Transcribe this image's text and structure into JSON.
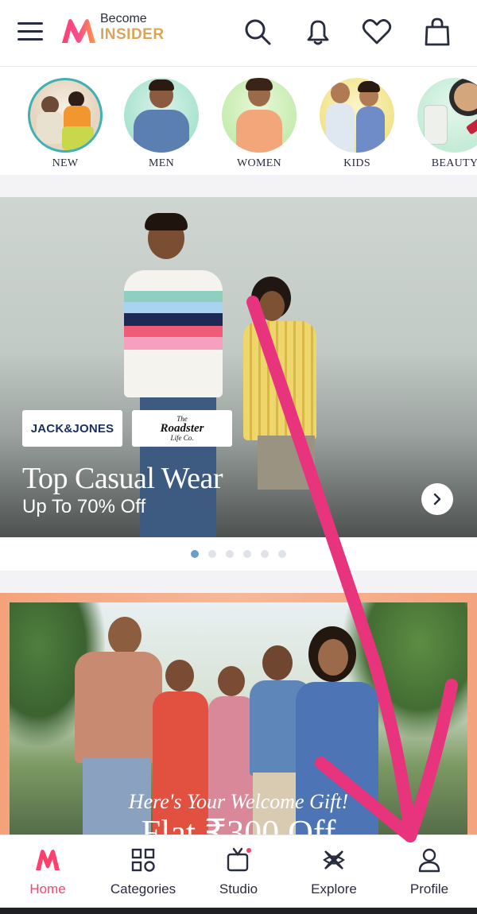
{
  "header": {
    "become_label": "Become",
    "insider_label": "INSIDER",
    "icons": [
      "hamburger-menu-icon",
      "myntra-logo",
      "search-icon",
      "notification-bell-icon",
      "wishlist-heart-icon",
      "shopping-bag-icon"
    ]
  },
  "categories": [
    {
      "label": "NEW",
      "icon": "category-new-image"
    },
    {
      "label": "MEN",
      "icon": "category-men-image"
    },
    {
      "label": "WOMEN",
      "icon": "category-women-image"
    },
    {
      "label": "KIDS",
      "icon": "category-kids-image"
    },
    {
      "label": "BEAUTY",
      "icon": "category-beauty-image"
    }
  ],
  "hero": {
    "brand_1": "JACK&JONES",
    "brand_2_top": "The",
    "brand_2_main": "Roadster",
    "brand_2_bottom": "Life Co.",
    "title": "Top Casual Wear",
    "subtitle": "Up To 70% Off",
    "carousel_total": 6,
    "carousel_active_index": 0
  },
  "promo": {
    "caption": "Here's Your Welcome Gift!",
    "offer": "Flat ₹300 Off"
  },
  "bottom_nav": {
    "items": [
      {
        "label": "Home",
        "icon": "home-myntra-icon",
        "active": true
      },
      {
        "label": "Categories",
        "icon": "categories-grid-icon",
        "active": false
      },
      {
        "label": "Studio",
        "icon": "studio-tv-icon",
        "active": false
      },
      {
        "label": "Explore",
        "icon": "explore-icon",
        "active": false
      },
      {
        "label": "Profile",
        "icon": "profile-person-icon",
        "active": false
      }
    ]
  },
  "colors": {
    "accent": "#ff3f6c",
    "insider_gold": "#d9a55b",
    "text": "#282c3f",
    "annotation_arrow": "#e8347c"
  }
}
